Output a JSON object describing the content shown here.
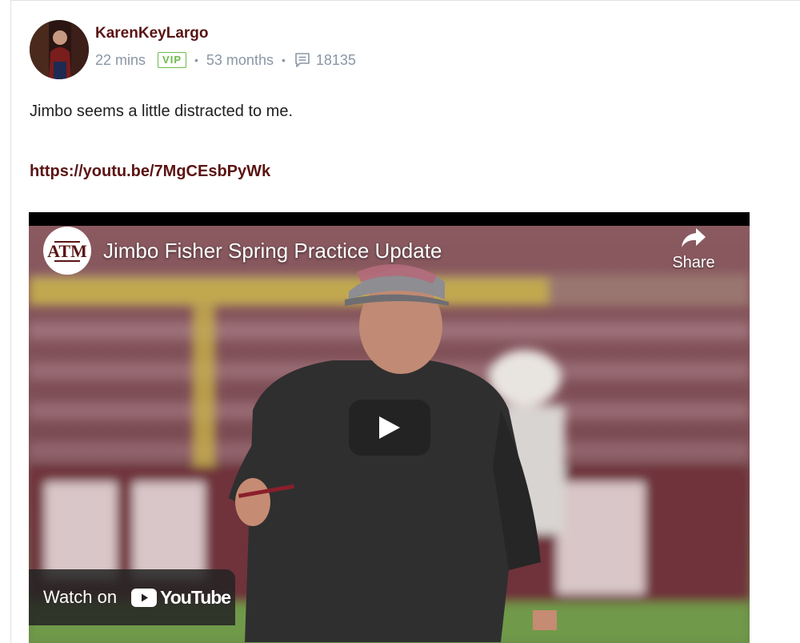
{
  "post": {
    "username": "KarenKeyLargo",
    "time": "22 mins",
    "badge": "VIP",
    "tenure": "53 months",
    "comment_count": "18135",
    "text": "Jimbo seems a little distracted to me.",
    "link": "https://youtu.be/7MgCEsbPyWk"
  },
  "video": {
    "title": "Jimbo Fisher Spring Practice Update",
    "share_label": "Share",
    "watch_on_label": "Watch on",
    "youtube_label": "YouTube",
    "channel_logo_text": "ATM"
  },
  "colors": {
    "brand_maroon": "#5b1414",
    "meta_gray": "#8a97a6",
    "vip_green": "#6dbb4a"
  },
  "icons": [
    "avatar",
    "comment-icon",
    "share-arrow-icon",
    "play-icon",
    "youtube-icon"
  ]
}
